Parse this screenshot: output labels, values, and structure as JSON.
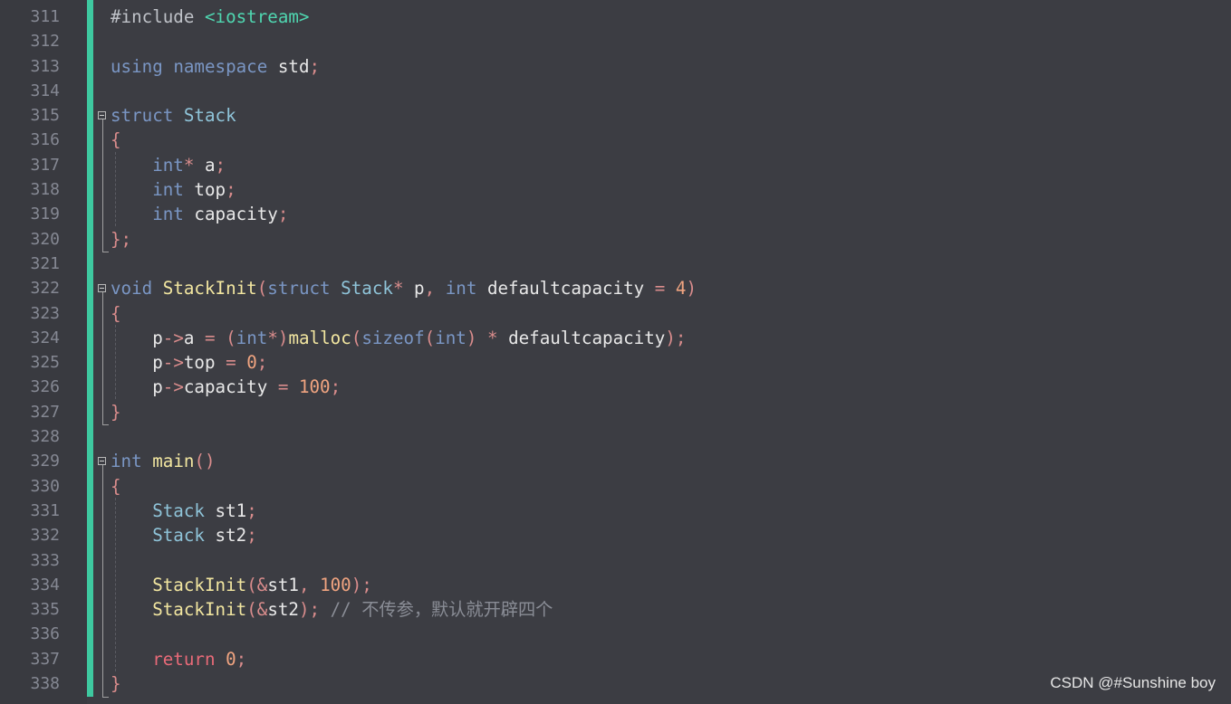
{
  "editor": {
    "line_numbers": [
      "311",
      "312",
      "313",
      "314",
      "315",
      "316",
      "317",
      "318",
      "319",
      "320",
      "321",
      "322",
      "323",
      "324",
      "325",
      "326",
      "327",
      "328",
      "329",
      "330",
      "331",
      "332",
      "333",
      "334",
      "335",
      "336",
      "337",
      "338"
    ],
    "lines": [
      [
        [
          "pp",
          "#include "
        ],
        [
          "str",
          "<iostream>"
        ]
      ],
      [],
      [
        [
          "k",
          "using "
        ],
        [
          "k",
          "namespace "
        ],
        [
          "id",
          "std"
        ],
        [
          "p",
          ";"
        ]
      ],
      [],
      [
        [
          "k",
          "struct "
        ],
        [
          "ty",
          "Stack"
        ]
      ],
      [
        [
          "p",
          "{"
        ]
      ],
      [
        [
          "k",
          "    int"
        ],
        [
          "op",
          "* "
        ],
        [
          "id",
          "a"
        ],
        [
          "p",
          ";"
        ]
      ],
      [
        [
          "k",
          "    int "
        ],
        [
          "id",
          "top"
        ],
        [
          "p",
          ";"
        ]
      ],
      [
        [
          "k",
          "    int "
        ],
        [
          "id",
          "capacity"
        ],
        [
          "p",
          ";"
        ]
      ],
      [
        [
          "p",
          "};"
        ]
      ],
      [],
      [
        [
          "k",
          "void "
        ],
        [
          "fn",
          "StackInit"
        ],
        [
          "p",
          "("
        ],
        [
          "k",
          "struct "
        ],
        [
          "ty",
          "Stack"
        ],
        [
          "op",
          "* "
        ],
        [
          "id",
          "p"
        ],
        [
          "p",
          ", "
        ],
        [
          "k",
          "int "
        ],
        [
          "id",
          "defaultcapacity "
        ],
        [
          "op",
          "= "
        ],
        [
          "num",
          "4"
        ],
        [
          "p",
          ")"
        ]
      ],
      [
        [
          "p",
          "{"
        ]
      ],
      [
        [
          "id",
          "    p"
        ],
        [
          "op",
          "->"
        ],
        [
          "mem",
          "a "
        ],
        [
          "op",
          "= "
        ],
        [
          "p",
          "("
        ],
        [
          "k",
          "int"
        ],
        [
          "op",
          "*"
        ],
        [
          "p",
          ")"
        ],
        [
          "fn",
          "malloc"
        ],
        [
          "p",
          "("
        ],
        [
          "k",
          "sizeof"
        ],
        [
          "p",
          "("
        ],
        [
          "k",
          "int"
        ],
        [
          "p",
          ") "
        ],
        [
          "op",
          "* "
        ],
        [
          "id",
          "defaultcapacity"
        ],
        [
          "p",
          ");"
        ]
      ],
      [
        [
          "id",
          "    p"
        ],
        [
          "op",
          "->"
        ],
        [
          "mem",
          "top "
        ],
        [
          "op",
          "= "
        ],
        [
          "num",
          "0"
        ],
        [
          "p",
          ";"
        ]
      ],
      [
        [
          "id",
          "    p"
        ],
        [
          "op",
          "->"
        ],
        [
          "mem",
          "capacity "
        ],
        [
          "op",
          "= "
        ],
        [
          "num",
          "100"
        ],
        [
          "p",
          ";"
        ]
      ],
      [
        [
          "p",
          "}"
        ]
      ],
      [],
      [
        [
          "k",
          "int "
        ],
        [
          "fn",
          "main"
        ],
        [
          "p",
          "()"
        ]
      ],
      [
        [
          "p",
          "{"
        ]
      ],
      [
        [
          "ty",
          "    Stack "
        ],
        [
          "id",
          "st1"
        ],
        [
          "p",
          ";"
        ]
      ],
      [
        [
          "ty",
          "    Stack "
        ],
        [
          "id",
          "st2"
        ],
        [
          "p",
          ";"
        ]
      ],
      [],
      [
        [
          "fn",
          "    StackInit"
        ],
        [
          "p",
          "("
        ],
        [
          "op",
          "&"
        ],
        [
          "id",
          "st1"
        ],
        [
          "p",
          ", "
        ],
        [
          "num",
          "100"
        ],
        [
          "p",
          ");"
        ]
      ],
      [
        [
          "fn",
          "    StackInit"
        ],
        [
          "p",
          "("
        ],
        [
          "op",
          "&"
        ],
        [
          "id",
          "st2"
        ],
        [
          "p",
          "); "
        ],
        [
          "cm",
          "// 不传参，默认就开辟四个"
        ]
      ],
      [],
      [
        [
          "ret",
          "    return "
        ],
        [
          "num",
          "0"
        ],
        [
          "p",
          ";"
        ]
      ],
      [
        [
          "p",
          "}"
        ]
      ]
    ],
    "colors": {
      "background": "#3c3d43",
      "change_bar": "#3ec9a0",
      "keyword": "#7a96c4",
      "type": "#8fc4d9",
      "function": "#f2e6a0",
      "number": "#f0a480",
      "punctuation": "#d98c8c",
      "return_keyword": "#e86a78",
      "string": "#4fd6b0",
      "comment": "#8a8d96"
    },
    "fold_markers": [
      "315",
      "322",
      "329"
    ]
  },
  "watermark": {
    "text": "CSDN @#Sunshine boy"
  }
}
